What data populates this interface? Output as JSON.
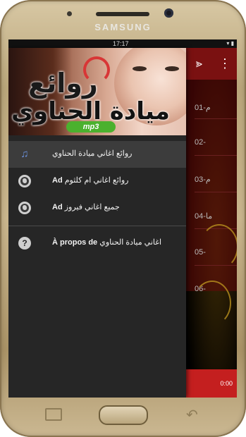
{
  "device": {
    "brand": "SAMSUNG",
    "status_time": "17:17",
    "status_icons": "▾ ▮"
  },
  "drawer": {
    "header": {
      "title_line1": "روائع",
      "title_line2": "ميادة الحناوي",
      "badge": "mp3"
    },
    "items": [
      {
        "label": "روائع اغاني ميادة الحناوي",
        "prefix": "",
        "icon": "music-note-icon",
        "active": true
      },
      {
        "label": "روائع اغاني ام كلثوم",
        "prefix": "Ad",
        "icon": "globe-icon",
        "active": false
      },
      {
        "label": "جميع اغاني فيروز",
        "prefix": "Ad",
        "icon": "globe-icon",
        "active": false
      },
      {
        "label": "اغاني ميادة الحناوي",
        "prefix": "À propos de",
        "icon": "help-icon",
        "active": false
      }
    ]
  },
  "background_app": {
    "tracks": [
      "01-م",
      "02-",
      "03-م",
      "04-ما",
      "05-",
      "06-"
    ],
    "player_time": "0:00"
  },
  "colors": {
    "toolbar": "#7a1111",
    "player": "#c41f1f",
    "drawer": "#262626",
    "active_item": "#3c3c3c"
  }
}
